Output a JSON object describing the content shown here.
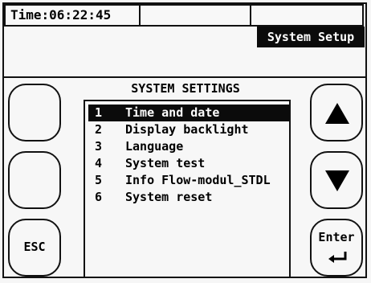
{
  "status": {
    "time_label": "Time:06:22:45"
  },
  "header": {
    "mode": "System Setup"
  },
  "settings": {
    "title": "SYSTEM SETTINGS",
    "items": [
      {
        "num": "1",
        "label": "Time and date",
        "selected": true
      },
      {
        "num": "2",
        "label": "Display backlight",
        "selected": false
      },
      {
        "num": "3",
        "label": "Language",
        "selected": false
      },
      {
        "num": "4",
        "label": "System test",
        "selected": false
      },
      {
        "num": "5",
        "label": "Info Flow-modul_STDL",
        "selected": false
      },
      {
        "num": "6",
        "label": "System reset",
        "selected": false
      }
    ]
  },
  "buttons": {
    "esc_label": "ESC",
    "enter_label": "Enter",
    "up_icon": "arrow-up-icon",
    "down_icon": "arrow-down-icon",
    "enter_icon": "enter-return-icon"
  },
  "colors": {
    "highlight": "#0b0b0b",
    "background": "#f7f7f7",
    "text": "#000000"
  }
}
